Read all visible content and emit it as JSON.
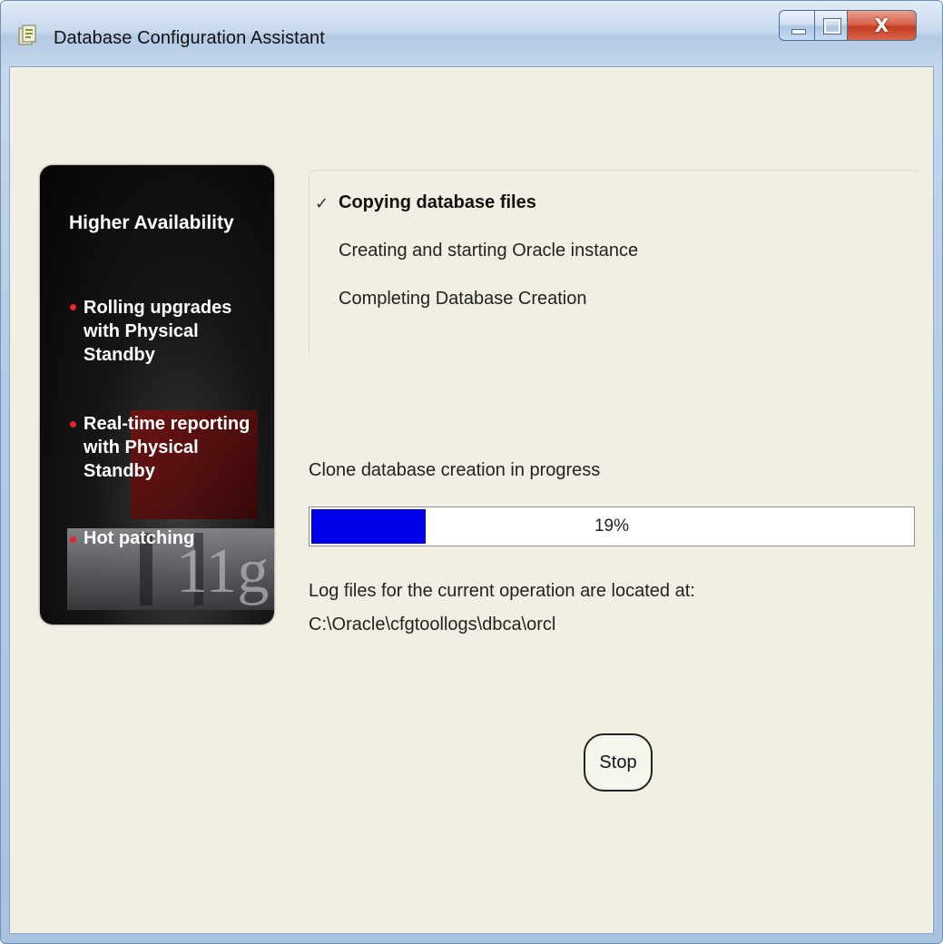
{
  "window": {
    "title": "Database Configuration Assistant",
    "controls": {
      "minimize_icon": "minimize-icon",
      "maximize_icon": "maximize-icon",
      "close_icon": "close-icon",
      "close_glyph": "X"
    }
  },
  "promo": {
    "heading": "Higher Availability",
    "items": [
      {
        "line1": "Rolling upgrades",
        "line2": "with Physical",
        "line3": "Standby"
      },
      {
        "line1": "Real-time reporting",
        "line2": "with Physical",
        "line3": "Standby"
      },
      {
        "line1": "Hot patching"
      }
    ],
    "bullet_color": "#e8232a",
    "logo_text": "11g"
  },
  "steps": [
    {
      "label": "Copying database files",
      "status": "done",
      "mark": "✓"
    },
    {
      "label": "Creating and starting Oracle instance",
      "status": "pending"
    },
    {
      "label": "Completing Database Creation",
      "status": "pending"
    }
  ],
  "progress": {
    "status_text": "Clone database creation in progress",
    "percent": 19,
    "label": "19%",
    "fill_color": "#0000e8"
  },
  "log": {
    "label": "Log files for the current operation are located at:",
    "path": "C:\\Oracle\\cfgtoollogs\\dbca\\orcl"
  },
  "actions": {
    "stop_label": "Stop"
  }
}
